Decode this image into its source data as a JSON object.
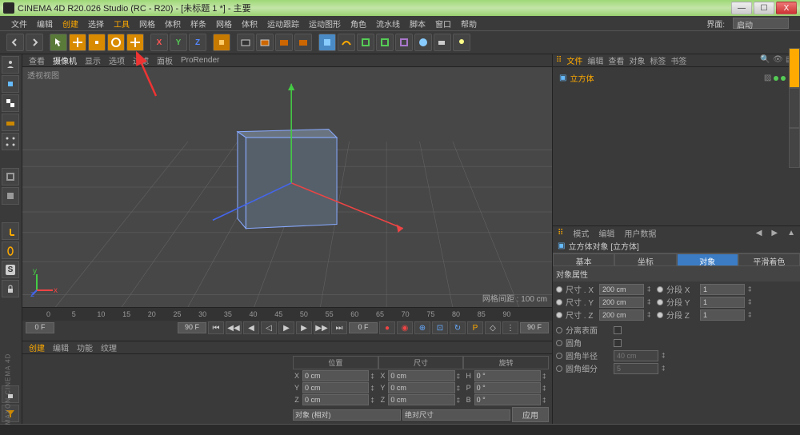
{
  "titlebar": {
    "text": "CINEMA 4D R20.026 Studio (RC - R20) - [未标题 1 *] - 主要"
  },
  "win_btns": {
    "min": "—",
    "max": "☐",
    "close": "X"
  },
  "menubar": {
    "items": [
      "文件",
      "编辑",
      "创建",
      "选择",
      "工具",
      "网格",
      "体积",
      "样条",
      "网格",
      "体积",
      "运动跟踪",
      "运动图形",
      "角色",
      "流水线",
      "脚本",
      "窗口",
      "帮助"
    ],
    "layout_label": "界面:",
    "layout_value": "启动"
  },
  "viewport_menu": {
    "items": [
      "查看",
      "摄像机",
      "显示",
      "选项",
      "过滤",
      "面板",
      "ProRender"
    ]
  },
  "viewport": {
    "label": "透视视图",
    "grid_info": "网格间距 : 100 cm"
  },
  "timeline": {
    "ticks": [
      "0",
      "5",
      "10",
      "15",
      "20",
      "25",
      "30",
      "35",
      "40",
      "45",
      "50",
      "55",
      "60",
      "65",
      "70",
      "75",
      "80",
      "85",
      "90"
    ],
    "start": "0 F",
    "end": "90 F",
    "cur": "0 F",
    "end2": "90 F"
  },
  "bottom_tabs": [
    "创建",
    "编辑",
    "功能",
    "纹理"
  ],
  "coord": {
    "headers": [
      "位置",
      "尺寸",
      "旋转"
    ],
    "rows": [
      {
        "axis": "X",
        "pos": "0 cm",
        "size": "0 cm",
        "rot": "0 °",
        "rk": "H"
      },
      {
        "axis": "Y",
        "pos": "0 cm",
        "size": "0 cm",
        "rot": "0 °",
        "rk": "P"
      },
      {
        "axis": "Z",
        "pos": "0 cm",
        "size": "0 cm",
        "rot": "0 °",
        "rk": "B"
      }
    ],
    "mode": "对象 (相对)",
    "size_mode": "绝对尺寸",
    "apply": "应用"
  },
  "om": {
    "tabs": [
      "文件",
      "编辑",
      "查看",
      "对象",
      "标签",
      "书签"
    ],
    "item": {
      "name": "立方体"
    }
  },
  "attr": {
    "mode_tabs": [
      "模式",
      "编辑",
      "用户数据"
    ],
    "title": "立方体对象 [立方体]",
    "sub_tabs": [
      "基本",
      "坐标",
      "对象",
      "平滑着色(Phong)"
    ],
    "section": "对象属性",
    "rows": [
      {
        "l1": "尺寸 . X",
        "v1": "200 cm",
        "l2": "分段 X",
        "v2": "1"
      },
      {
        "l1": "尺寸 . Y",
        "v1": "200 cm",
        "l2": "分段 Y",
        "v2": "1"
      },
      {
        "l1": "尺寸 . Z",
        "v1": "200 cm",
        "l2": "分段 Z",
        "v2": "1"
      }
    ],
    "extras": [
      {
        "label": "分离表面"
      },
      {
        "label": "圆角"
      },
      {
        "label": "圆角半径",
        "value": "40 cm",
        "dis": true
      },
      {
        "label": "圆角细分",
        "value": "5",
        "dis": true
      }
    ]
  },
  "maxon": "MAXON  CINEMA 4D",
  "edge_tabs": [
    "",
    "",
    ""
  ]
}
